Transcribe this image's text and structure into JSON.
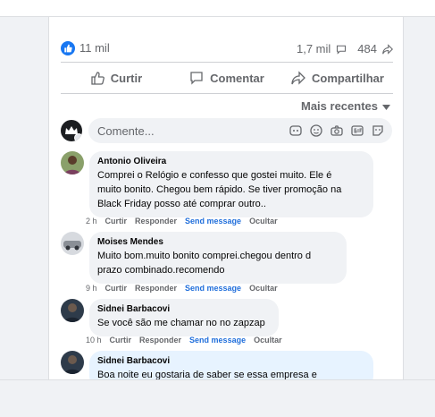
{
  "post": {
    "likes": "11 mil",
    "comments_count": "1,7 mil",
    "shares_count": "484",
    "colors": {
      "accent": "#1877f2",
      "link": "#216fdb",
      "muted": "#65676b",
      "bubble": "#f0f2f5",
      "highlight_bubble": "#e7f3ff"
    }
  },
  "actions": {
    "like": "Curtir",
    "comment": "Comentar",
    "share": "Compartilhar"
  },
  "sort": {
    "label": "Mais recentes"
  },
  "composer": {
    "placeholder": "Comente...",
    "icons": [
      "sticker-icon",
      "emoji-icon",
      "camera-icon",
      "gif-icon",
      "sticker-face-icon"
    ]
  },
  "comments": [
    {
      "author": "Antonio Oliveira",
      "text": "Comprei o Relógio e confesso que gostei muito. Ele é\nmuito bonito. Chegou bem rápido. Se tiver promoção na\nBlack Friday posso até comprar outro..",
      "time": "2 h",
      "like": "Curtir",
      "reply": "Responder",
      "send": "Send message",
      "hide": "Ocultar"
    },
    {
      "author": "Moises Mendes",
      "text": "Muito bom.muito bonito comprei.chegou dentro d\nprazo combinado.recomendo",
      "time": "9 h",
      "like": "Curtir",
      "reply": "Responder",
      "send": "Send message",
      "hide": "Ocultar"
    },
    {
      "author": "Sidnei Barbacovi",
      "text": "Se você são me chamar no no zapzap",
      "time": "10 h",
      "like": "Curtir",
      "reply": "Responder",
      "send": "Send message",
      "hide": "Ocultar"
    },
    {
      "author": "Sidnei Barbacovi",
      "text": "Boa noite eu gostaria de saber se essa empresa e"
    }
  ]
}
